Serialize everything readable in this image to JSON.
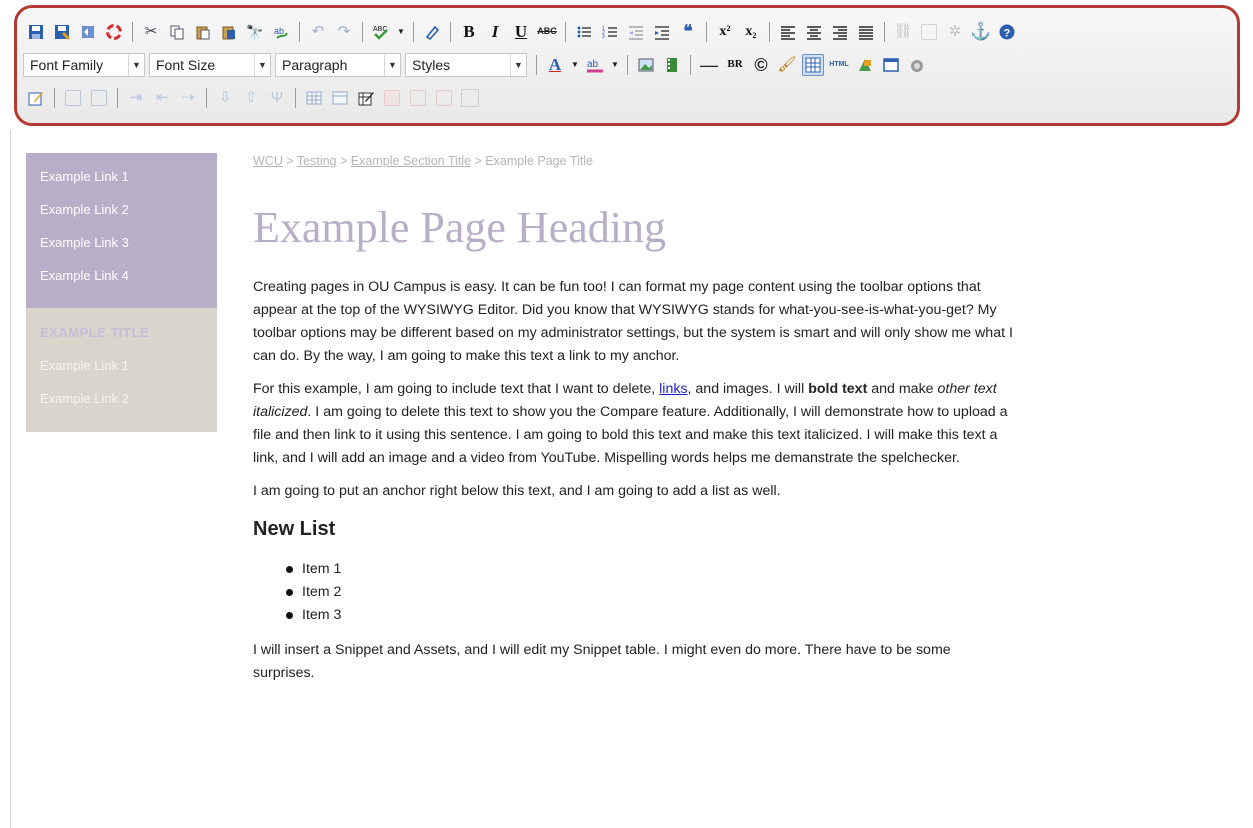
{
  "toolbar": {
    "font_family": "Font Family",
    "font_size": "Font Size",
    "paragraph": "Paragraph",
    "styles": "Styles",
    "bold": "B",
    "italic": "I",
    "underline": "U",
    "strike": "ABC",
    "superscript": "x²",
    "subscript": "x₂",
    "br": "BR",
    "html": "HTML"
  },
  "sidebar": {
    "links_top": [
      "Example Link 1",
      "Example Link 2",
      "Example Link 3",
      "Example Link 4"
    ],
    "section_title": "EXAMPLE TITLE",
    "links_bottom": [
      "Example Link 1",
      "Example Link 2"
    ]
  },
  "breadcrumb": {
    "items": [
      "WCU",
      "Testing",
      "Example Section Title"
    ],
    "separator": ">",
    "current": "Example Page Title"
  },
  "content": {
    "heading": "Example Page Heading",
    "p1": "Creating pages in OU Campus is easy. It can be fun too! I can format my page content using the toolbar options that appear at the top of the WYSIWYG Editor. Did you know that WYSIWYG stands for what-you-see-is-what-you-get? My toolbar options may be different based on my administrator settings, but the system is smart and will only show me what I can do. By the way, I am going to make this text a link to my anchor.",
    "p2_a": "For this example, I am going to include text that I want to delete, ",
    "p2_link": "links",
    "p2_b": ", and images. I will ",
    "p2_bold": "bold text",
    "p2_c": " and make ",
    "p2_italic": "other text italicized",
    "p2_d": ". I am going to delete this text to show you the Compare feature. Additionally, I will demonstrate how to upload a file and then link to it using this sentence. I am going to bold this text and make this text italicized. I will make this text a link, and I will add an image and a video from YouTube. Mispelling words helps me demanstrate the spelchecker.",
    "p3": "I am going to put an anchor right below this text, and I am going to add a list as well.",
    "list_heading": "New List",
    "list_items": [
      "Item 1",
      "Item 2",
      "Item 3"
    ],
    "p4": "I will insert a Snippet and Assets, and I will edit my Snippet table. I might even do more. There have to be some surprises."
  },
  "colors": {
    "toolbar_border": "#b23a33",
    "sidebar_purple": "#b8aec8",
    "sidebar_grey": "#d9d5cd",
    "heading": "#b8aec8",
    "link": "#2222cc"
  }
}
